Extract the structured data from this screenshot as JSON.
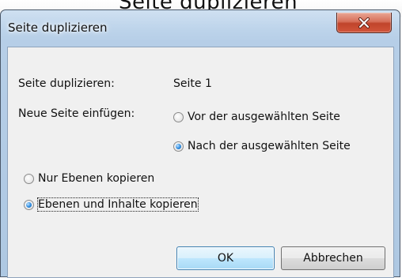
{
  "background_window": {
    "partial_title": "Seite duplizieren"
  },
  "dialog": {
    "title": "Seite duplizieren",
    "close_icon": "close-x-icon",
    "page_label": "Seite duplizieren:",
    "page_value": "Seite 1",
    "insert_label": "Neue Seite einfügen:",
    "insert_options": [
      {
        "label": "Vor der ausgewählten Seite",
        "selected": false
      },
      {
        "label": "Nach der ausgewählten Seite",
        "selected": true
      }
    ],
    "copy_options": [
      {
        "label": "Nur Ebenen kopieren",
        "selected": false
      },
      {
        "label": "Ebenen und Inhalte kopieren",
        "selected": true
      }
    ],
    "ok_label": "OK",
    "cancel_label": "Abbrechen"
  },
  "colors": {
    "frame": "#b6cee7",
    "client": "#f0f0f0",
    "close_button": "#c0442b",
    "default_button_border": "#3c7fb1"
  }
}
